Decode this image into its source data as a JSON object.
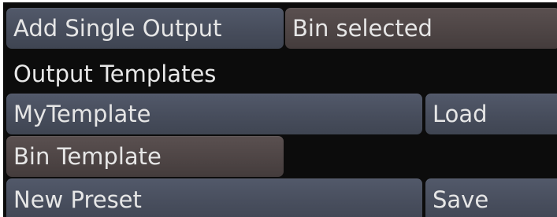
{
  "row1": {
    "add_single_output": "Add Single Output",
    "bin_selected": "Bin selected"
  },
  "section_title": "Output Templates",
  "template_row": {
    "template_name": "MyTemplate",
    "load_label": "Load"
  },
  "bin_template": "Bin Template",
  "preset_row": {
    "preset_name": "New Preset",
    "save_label": "Save"
  },
  "colors": {
    "background": "#0c0c0c",
    "button_blue": "#4b5160",
    "button_brown": "#504747",
    "text": "#e6e6e6"
  }
}
